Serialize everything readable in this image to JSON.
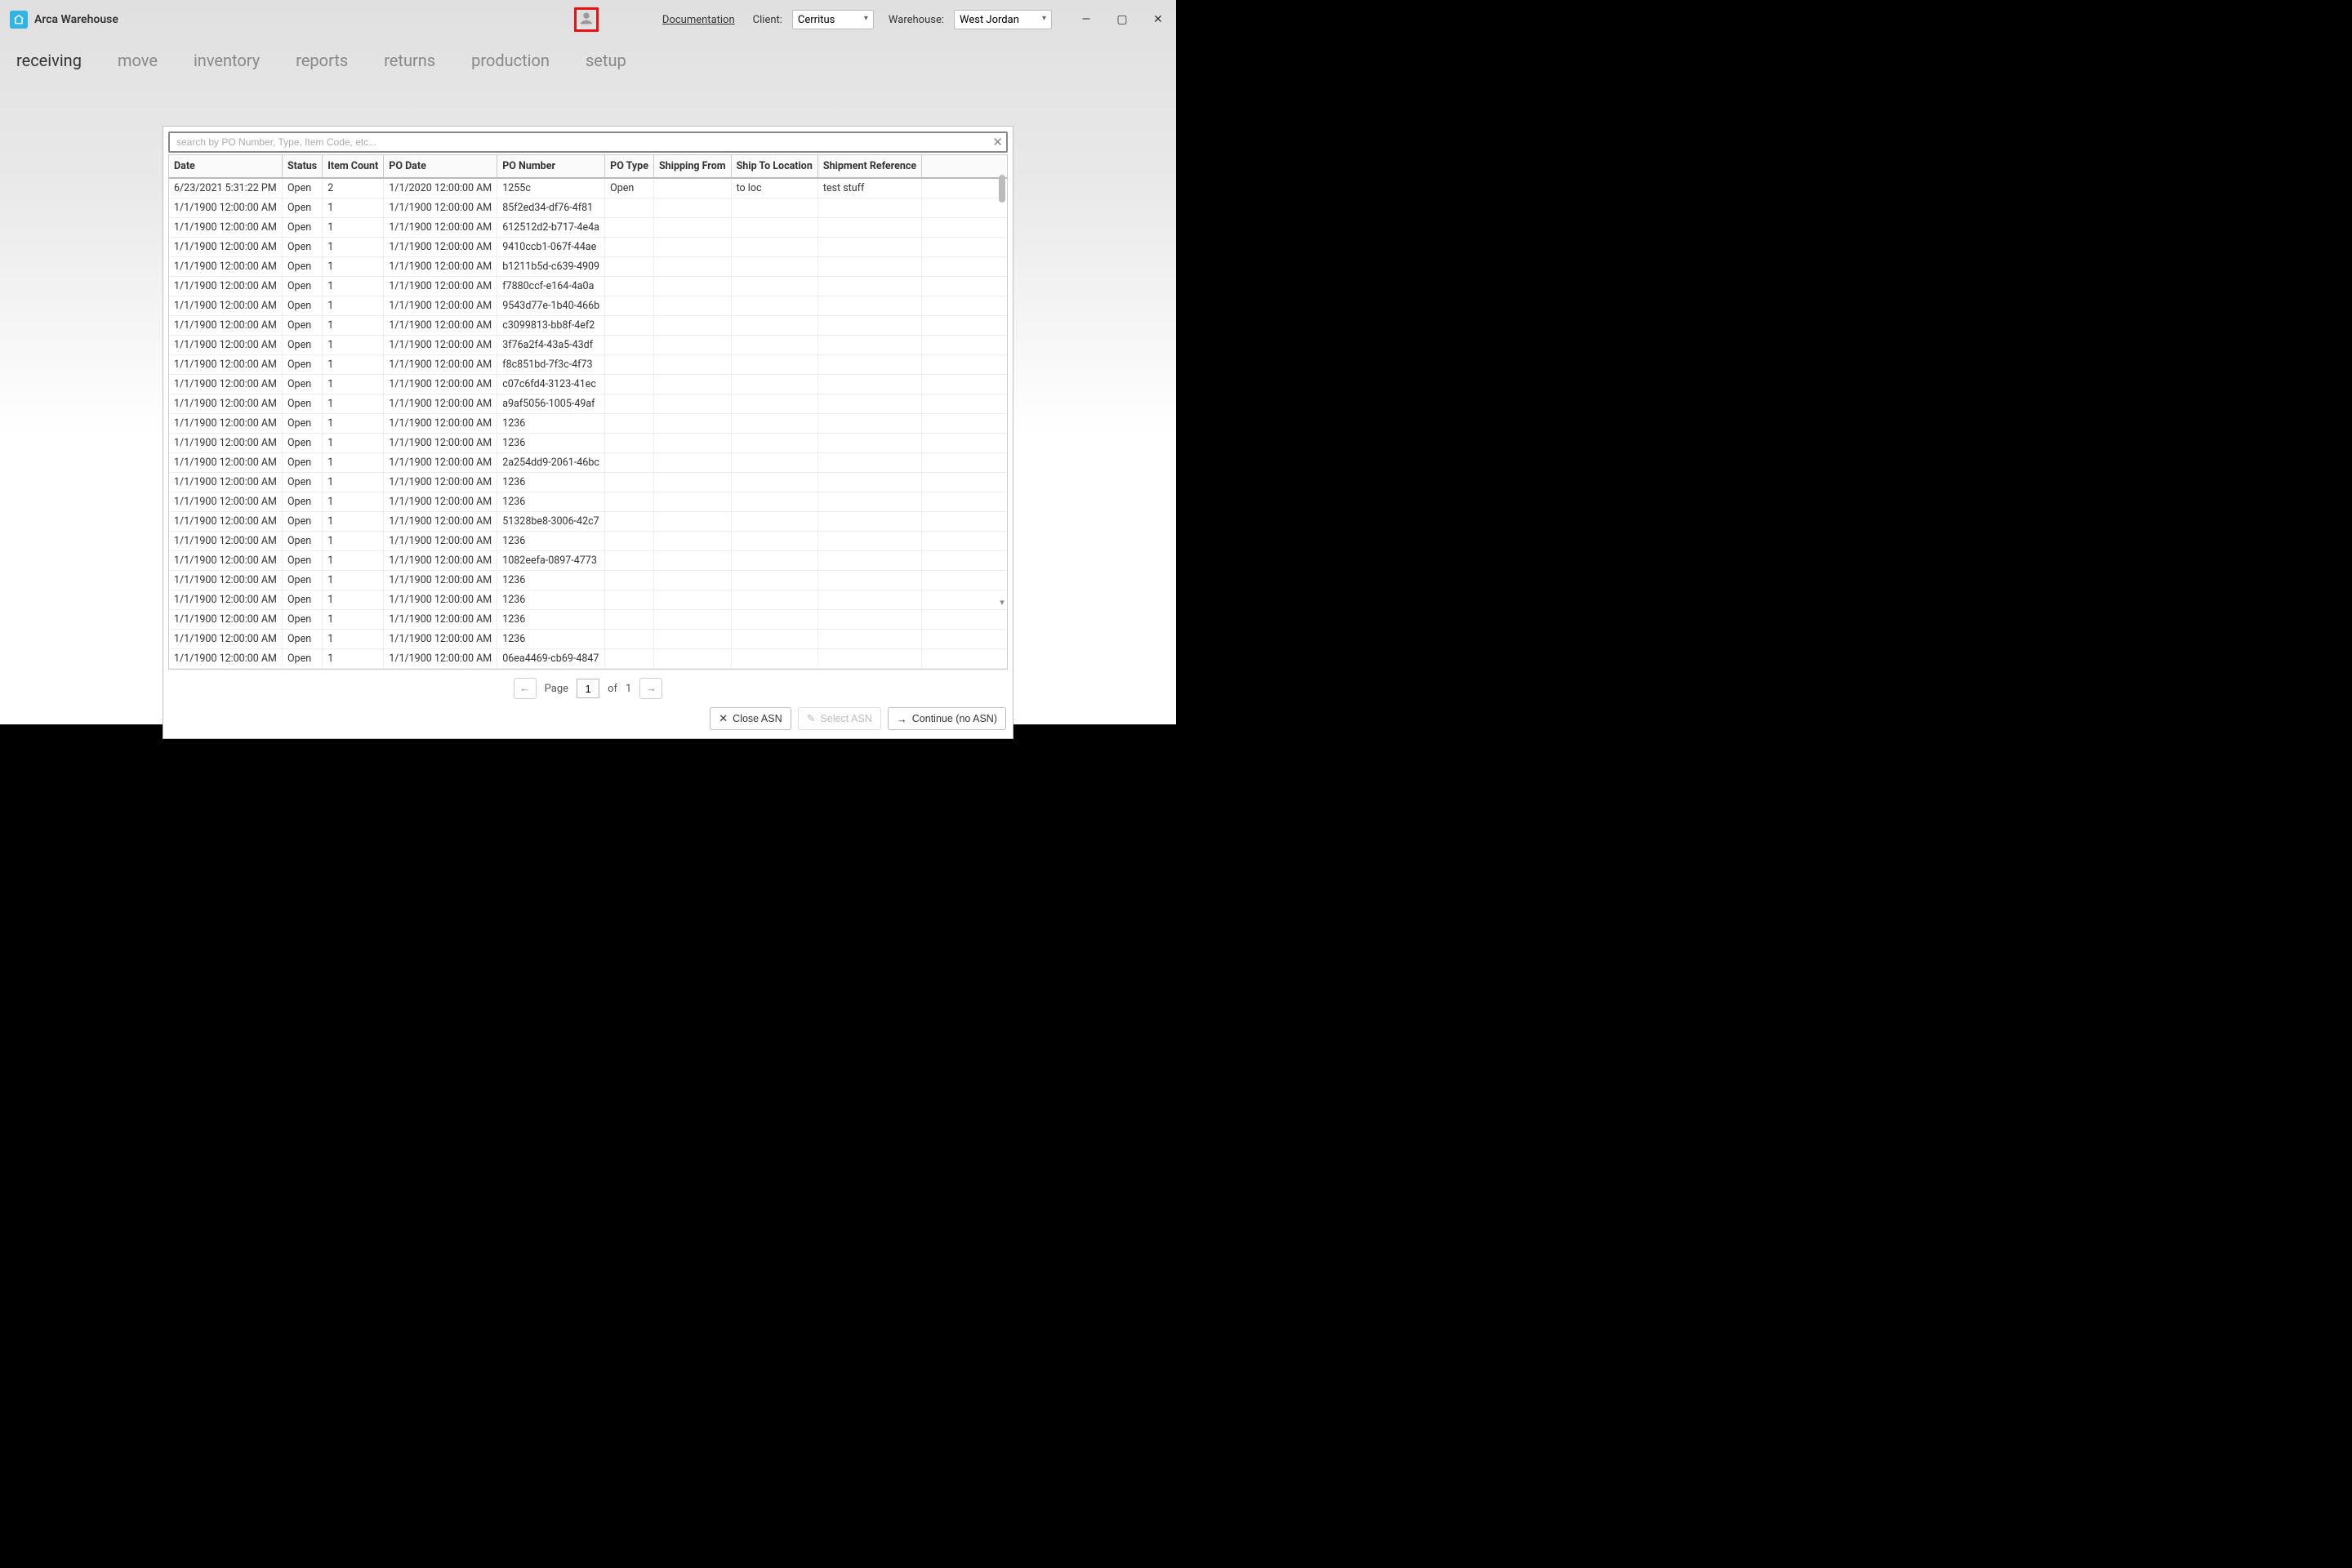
{
  "app": {
    "title": "Arca Warehouse"
  },
  "header": {
    "documentation": "Documentation",
    "client_label": "Client:",
    "client_value": "Cerritus",
    "warehouse_label": "Warehouse:",
    "warehouse_value": "West Jordan"
  },
  "nav": {
    "items": [
      "receiving",
      "move",
      "inventory",
      "reports",
      "returns",
      "production",
      "setup"
    ],
    "active": 0
  },
  "search": {
    "placeholder": "search by PO Number, Type, Item Code, etc..."
  },
  "columns": [
    "Date",
    "Status",
    "Item Count",
    "PO Date",
    "PO Number",
    "PO Type",
    "Shipping From",
    "Ship To Location",
    "Shipment Reference"
  ],
  "rows": [
    {
      "date": "6/23/2021 5:31:22 PM",
      "status": "Open",
      "count": "2",
      "podate": "1/1/2020 12:00:00 AM",
      "ponum": "1255c",
      "potype": "Open",
      "shipfrom": "",
      "shipto": "to loc",
      "shipref": "test stuff"
    },
    {
      "date": "1/1/1900 12:00:00 AM",
      "status": "Open",
      "count": "1",
      "podate": "1/1/1900 12:00:00 AM",
      "ponum": "85f2ed34-df76-4f81",
      "potype": "",
      "shipfrom": "",
      "shipto": "",
      "shipref": ""
    },
    {
      "date": "1/1/1900 12:00:00 AM",
      "status": "Open",
      "count": "1",
      "podate": "1/1/1900 12:00:00 AM",
      "ponum": "612512d2-b717-4e4a",
      "potype": "",
      "shipfrom": "",
      "shipto": "",
      "shipref": ""
    },
    {
      "date": "1/1/1900 12:00:00 AM",
      "status": "Open",
      "count": "1",
      "podate": "1/1/1900 12:00:00 AM",
      "ponum": "9410ccb1-067f-44ae",
      "potype": "",
      "shipfrom": "",
      "shipto": "",
      "shipref": ""
    },
    {
      "date": "1/1/1900 12:00:00 AM",
      "status": "Open",
      "count": "1",
      "podate": "1/1/1900 12:00:00 AM",
      "ponum": "b1211b5d-c639-4909",
      "potype": "",
      "shipfrom": "",
      "shipto": "",
      "shipref": ""
    },
    {
      "date": "1/1/1900 12:00:00 AM",
      "status": "Open",
      "count": "1",
      "podate": "1/1/1900 12:00:00 AM",
      "ponum": "f7880ccf-e164-4a0a",
      "potype": "",
      "shipfrom": "",
      "shipto": "",
      "shipref": ""
    },
    {
      "date": "1/1/1900 12:00:00 AM",
      "status": "Open",
      "count": "1",
      "podate": "1/1/1900 12:00:00 AM",
      "ponum": "9543d77e-1b40-466b",
      "potype": "",
      "shipfrom": "",
      "shipto": "",
      "shipref": ""
    },
    {
      "date": "1/1/1900 12:00:00 AM",
      "status": "Open",
      "count": "1",
      "podate": "1/1/1900 12:00:00 AM",
      "ponum": "c3099813-bb8f-4ef2",
      "potype": "",
      "shipfrom": "",
      "shipto": "",
      "shipref": ""
    },
    {
      "date": "1/1/1900 12:00:00 AM",
      "status": "Open",
      "count": "1",
      "podate": "1/1/1900 12:00:00 AM",
      "ponum": "3f76a2f4-43a5-43df",
      "potype": "",
      "shipfrom": "",
      "shipto": "",
      "shipref": ""
    },
    {
      "date": "1/1/1900 12:00:00 AM",
      "status": "Open",
      "count": "1",
      "podate": "1/1/1900 12:00:00 AM",
      "ponum": "f8c851bd-7f3c-4f73",
      "potype": "",
      "shipfrom": "",
      "shipto": "",
      "shipref": ""
    },
    {
      "date": "1/1/1900 12:00:00 AM",
      "status": "Open",
      "count": "1",
      "podate": "1/1/1900 12:00:00 AM",
      "ponum": "c07c6fd4-3123-41ec",
      "potype": "",
      "shipfrom": "",
      "shipto": "",
      "shipref": ""
    },
    {
      "date": "1/1/1900 12:00:00 AM",
      "status": "Open",
      "count": "1",
      "podate": "1/1/1900 12:00:00 AM",
      "ponum": "a9af5056-1005-49af",
      "potype": "",
      "shipfrom": "",
      "shipto": "",
      "shipref": ""
    },
    {
      "date": "1/1/1900 12:00:00 AM",
      "status": "Open",
      "count": "1",
      "podate": "1/1/1900 12:00:00 AM",
      "ponum": "1236",
      "potype": "",
      "shipfrom": "",
      "shipto": "",
      "shipref": ""
    },
    {
      "date": "1/1/1900 12:00:00 AM",
      "status": "Open",
      "count": "1",
      "podate": "1/1/1900 12:00:00 AM",
      "ponum": "1236",
      "potype": "",
      "shipfrom": "",
      "shipto": "",
      "shipref": ""
    },
    {
      "date": "1/1/1900 12:00:00 AM",
      "status": "Open",
      "count": "1",
      "podate": "1/1/1900 12:00:00 AM",
      "ponum": "2a254dd9-2061-46bc",
      "potype": "",
      "shipfrom": "",
      "shipto": "",
      "shipref": ""
    },
    {
      "date": "1/1/1900 12:00:00 AM",
      "status": "Open",
      "count": "1",
      "podate": "1/1/1900 12:00:00 AM",
      "ponum": "1236",
      "potype": "",
      "shipfrom": "",
      "shipto": "",
      "shipref": ""
    },
    {
      "date": "1/1/1900 12:00:00 AM",
      "status": "Open",
      "count": "1",
      "podate": "1/1/1900 12:00:00 AM",
      "ponum": "1236",
      "potype": "",
      "shipfrom": "",
      "shipto": "",
      "shipref": ""
    },
    {
      "date": "1/1/1900 12:00:00 AM",
      "status": "Open",
      "count": "1",
      "podate": "1/1/1900 12:00:00 AM",
      "ponum": "51328be8-3006-42c7",
      "potype": "",
      "shipfrom": "",
      "shipto": "",
      "shipref": ""
    },
    {
      "date": "1/1/1900 12:00:00 AM",
      "status": "Open",
      "count": "1",
      "podate": "1/1/1900 12:00:00 AM",
      "ponum": "1236",
      "potype": "",
      "shipfrom": "",
      "shipto": "",
      "shipref": ""
    },
    {
      "date": "1/1/1900 12:00:00 AM",
      "status": "Open",
      "count": "1",
      "podate": "1/1/1900 12:00:00 AM",
      "ponum": "1082eefa-0897-4773",
      "potype": "",
      "shipfrom": "",
      "shipto": "",
      "shipref": ""
    },
    {
      "date": "1/1/1900 12:00:00 AM",
      "status": "Open",
      "count": "1",
      "podate": "1/1/1900 12:00:00 AM",
      "ponum": "1236",
      "potype": "",
      "shipfrom": "",
      "shipto": "",
      "shipref": ""
    },
    {
      "date": "1/1/1900 12:00:00 AM",
      "status": "Open",
      "count": "1",
      "podate": "1/1/1900 12:00:00 AM",
      "ponum": "1236",
      "potype": "",
      "shipfrom": "",
      "shipto": "",
      "shipref": ""
    },
    {
      "date": "1/1/1900 12:00:00 AM",
      "status": "Open",
      "count": "1",
      "podate": "1/1/1900 12:00:00 AM",
      "ponum": "1236",
      "potype": "",
      "shipfrom": "",
      "shipto": "",
      "shipref": ""
    },
    {
      "date": "1/1/1900 12:00:00 AM",
      "status": "Open",
      "count": "1",
      "podate": "1/1/1900 12:00:00 AM",
      "ponum": "1236",
      "potype": "",
      "shipfrom": "",
      "shipto": "",
      "shipref": ""
    },
    {
      "date": "1/1/1900 12:00:00 AM",
      "status": "Open",
      "count": "1",
      "podate": "1/1/1900 12:00:00 AM",
      "ponum": "06ea4469-cb69-4847",
      "potype": "",
      "shipfrom": "",
      "shipto": "",
      "shipref": ""
    }
  ],
  "pager": {
    "page_label": "Page",
    "current": "1",
    "of_label": "of",
    "total": "1"
  },
  "footer": {
    "close_asn": "Close ASN",
    "select_asn": "Select ASN",
    "continue": "Continue (no ASN)"
  }
}
